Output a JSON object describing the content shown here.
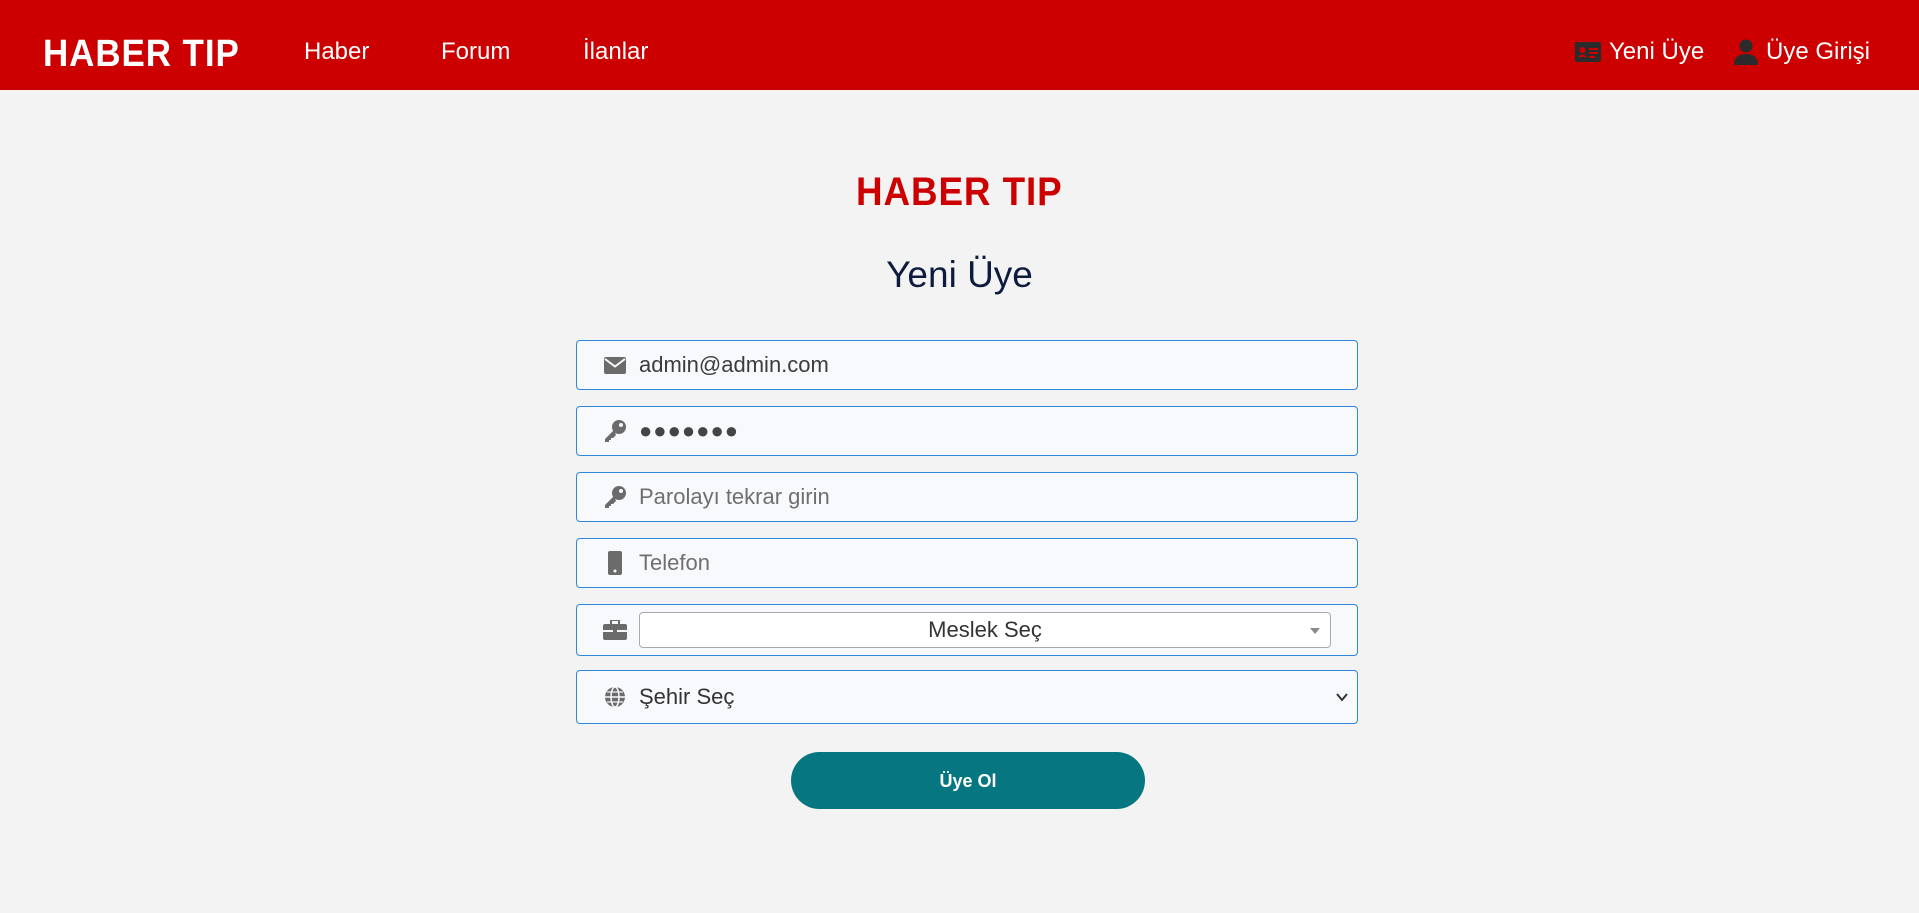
{
  "header": {
    "brand": "HABER TIP",
    "nav": [
      {
        "label": "Haber"
      },
      {
        "label": "Forum"
      },
      {
        "label": "İlanlar"
      }
    ],
    "register_label": "Yeni Üye",
    "login_label": "Üye Girişi"
  },
  "main": {
    "logo": "HABER TIP",
    "title": "Yeni Üye",
    "email": {
      "value": "admin@admin.com",
      "icon": "envelope-icon"
    },
    "password": {
      "value": "●●●●●●●",
      "icon": "key-icon"
    },
    "password_repeat": {
      "placeholder": "Parolayı tekrar girin",
      "icon": "key-icon"
    },
    "phone": {
      "placeholder": "Telefon",
      "icon": "mobile-phone-icon"
    },
    "job": {
      "selected": "Meslek Seç",
      "icon": "briefcase-icon"
    },
    "city": {
      "selected": "Şehir Seç",
      "icon": "globe-icon"
    },
    "submit_label": "Üye Ol"
  },
  "colors": {
    "header_bg": "#cc0000",
    "page_bg": "#f3f3f3",
    "title": "#0d1b3e",
    "field_border": "#2e86de",
    "button": "#067680"
  }
}
